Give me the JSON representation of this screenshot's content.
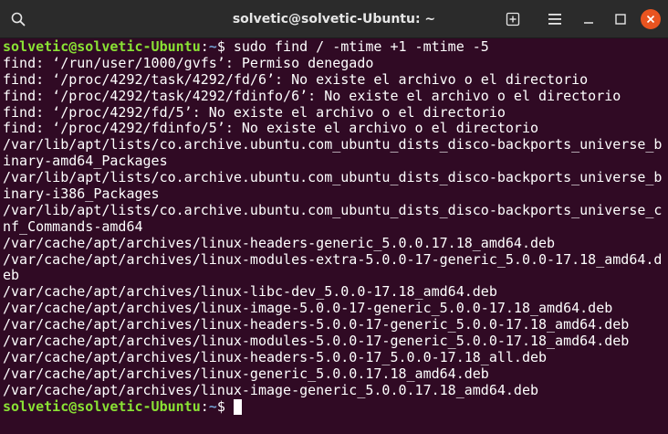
{
  "window": {
    "title": "solvetic@solvetic-Ubuntu: ~"
  },
  "titlebar": {
    "buttons": [
      "search-icon",
      "new-tab-icon",
      "menu-icon",
      "minimize-icon",
      "maximize-icon",
      "close-icon"
    ]
  },
  "colors": {
    "background": "#300a24",
    "prompt_user": "#8ae234",
    "prompt_path": "#729fcf",
    "close_button": "#e95420"
  },
  "terminal": {
    "prompt1": {
      "user_host": "solvetic@solvetic-Ubuntu",
      "sep": ":",
      "path": "~",
      "symbol": "$ ",
      "command": "sudo find / -mtime +1 -mtime -5"
    },
    "output": [
      "find: ‘/run/user/1000/gvfs’: Permiso denegado",
      "find: ‘/proc/4292/task/4292/fd/6’: No existe el archivo o el directorio",
      "find: ‘/proc/4292/task/4292/fdinfo/6’: No existe el archivo o el directorio",
      "find: ‘/proc/4292/fd/5’: No existe el archivo o el directorio",
      "find: ‘/proc/4292/fdinfo/5’: No existe el archivo o el directorio",
      "/var/lib/apt/lists/co.archive.ubuntu.com_ubuntu_dists_disco-backports_universe_b",
      "inary-amd64_Packages",
      "/var/lib/apt/lists/co.archive.ubuntu.com_ubuntu_dists_disco-backports_universe_b",
      "inary-i386_Packages",
      "/var/lib/apt/lists/co.archive.ubuntu.com_ubuntu_dists_disco-backports_universe_c",
      "nf_Commands-amd64",
      "/var/cache/apt/archives/linux-headers-generic_5.0.0.17.18_amd64.deb",
      "/var/cache/apt/archives/linux-modules-extra-5.0.0-17-generic_5.0.0-17.18_amd64.d",
      "eb",
      "/var/cache/apt/archives/linux-libc-dev_5.0.0-17.18_amd64.deb",
      "/var/cache/apt/archives/linux-image-5.0.0-17-generic_5.0.0-17.18_amd64.deb",
      "/var/cache/apt/archives/linux-headers-5.0.0-17-generic_5.0.0-17.18_amd64.deb",
      "/var/cache/apt/archives/linux-modules-5.0.0-17-generic_5.0.0-17.18_amd64.deb",
      "/var/cache/apt/archives/linux-headers-5.0.0-17_5.0.0-17.18_all.deb",
      "/var/cache/apt/archives/linux-generic_5.0.0.17.18_amd64.deb",
      "/var/cache/apt/archives/linux-image-generic_5.0.0.17.18_amd64.deb"
    ],
    "prompt2": {
      "user_host": "solvetic@solvetic-Ubuntu",
      "sep": ":",
      "path": "~",
      "symbol": "$ "
    }
  }
}
